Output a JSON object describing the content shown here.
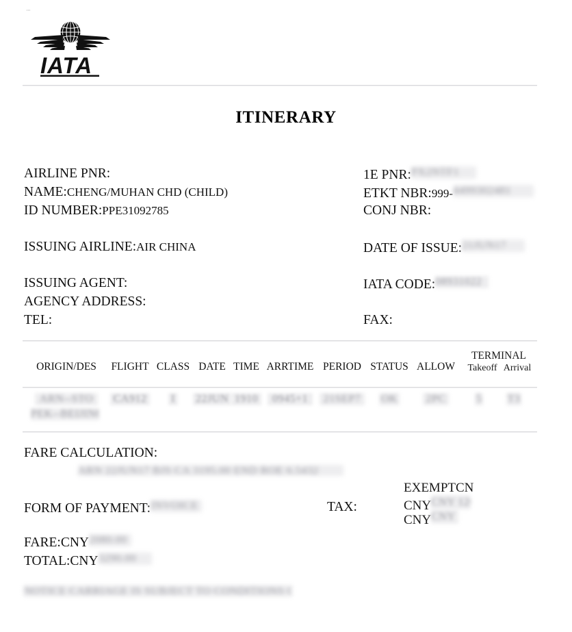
{
  "document": {
    "title": "ITINERARY",
    "top_artifact": "···",
    "logo": {
      "name": "IATA",
      "wordmark": "IATA"
    }
  },
  "passenger": {
    "airline_pnr_label": "AIRLINE PNR:",
    "airline_pnr_value": "",
    "name_label": "NAME:",
    "name_value": "CHENG/MUHAN CHD (CHILD)",
    "id_number_label": "ID NUMBER:",
    "id_number_value": "PPE31092785"
  },
  "booking": {
    "one_e_pnr_label": "1E PNR:",
    "one_e_pnr_value": "PX2NTF1",
    "etkt_nbr_label": "ETKT NBR:",
    "etkt_nbr_prefix": "999-",
    "etkt_nbr_value": "4499302481",
    "conj_nbr_label": "CONJ NBR:",
    "conj_nbr_value": ""
  },
  "issuing": {
    "airline_label": "ISSUING AIRLINE:",
    "airline_value": "AIR CHINA",
    "date_of_issue_label": "DATE OF ISSUE:",
    "date_of_issue_value": "21JUN17",
    "agent_label": "ISSUING AGENT:",
    "agent_value": "",
    "iata_code_label": "IATA CODE:",
    "iata_code_value": "08931022",
    "agency_address_label": "AGENCY ADDRESS:",
    "agency_address_value": "",
    "tel_label": "TEL:",
    "tel_value": "",
    "fax_label": "FAX:",
    "fax_value": ""
  },
  "flight_table": {
    "columns": [
      "ORIGIN/DES",
      "FLIGHT",
      "CLASS",
      "DATE",
      "TIME",
      "ARRTIME",
      "PERIOD",
      "STATUS",
      "ALLOW"
    ],
    "terminal_group": "TERMINAL",
    "terminal_sub": [
      "Takeoff",
      "Arrival"
    ],
    "rows": [
      {
        "origin_des_line1": "ARN--STO",
        "origin_des_line2": "PEK--BEIJING",
        "flight": "CA912",
        "class": "I",
        "date": "22JUN",
        "time": "1910",
        "arrtime": "0945+1",
        "period": "21SEP7",
        "status": "OK",
        "allow": "2PC",
        "terminal_takeoff": "5",
        "terminal_arrival": "T3"
      }
    ]
  },
  "fare": {
    "fare_calculation_label": "FARE CALCULATION:",
    "fare_calculation_value": "ARN 22JUN17 BJS CA 3195.00 END ROE 6.5432",
    "form_of_payment_label": "FORM OF PAYMENT:",
    "form_of_payment_value": "INVOICE",
    "tax_label": "TAX:",
    "tax_lines": [
      "EXEMPTCN",
      "CNY 120.00",
      "CNY 90.00"
    ],
    "fare_label": "FARE:CNY",
    "fare_value": "2080.00",
    "total_label": "TOTAL:CNY",
    "total_value": "3290.00"
  },
  "footer": {
    "notice": "NOTICE CARRIAGE IS SUBJECT TO CONDITIONS OF CONTRACT"
  }
}
